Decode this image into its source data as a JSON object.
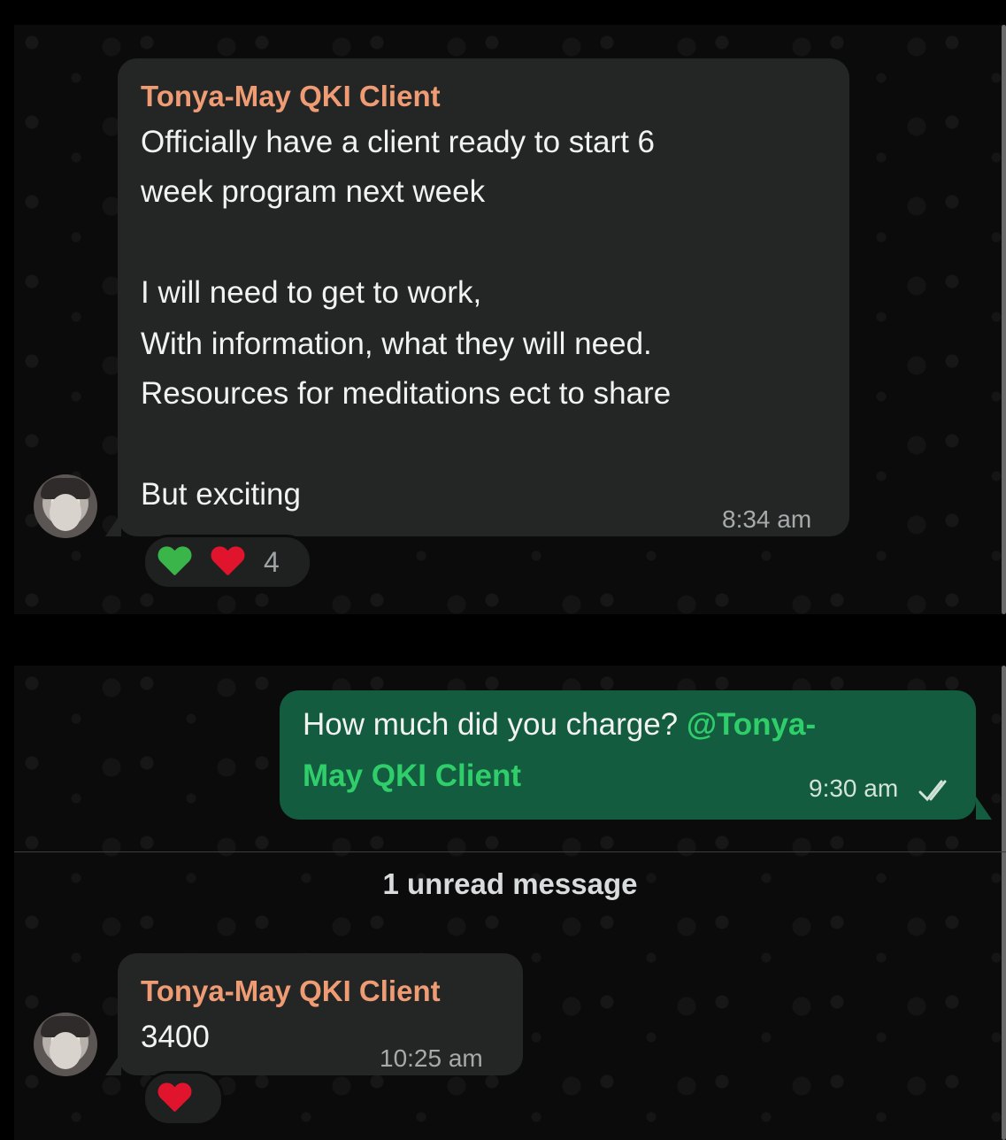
{
  "chat": {
    "message1": {
      "sender": "Tonya-May QKI Client",
      "lines": [
        "Officially have a client ready to start 6",
        "week program next week",
        "",
        "I will need to get to work,",
        "With information, what they will need.",
        "Resources for meditations ect to share",
        "",
        "But exciting"
      ],
      "time": "8:34 am",
      "reactions": {
        "emojis": [
          "green-heart",
          "red-heart"
        ],
        "count": "4"
      }
    },
    "message2": {
      "text_prefix": "How much did you charge?",
      "mention_part1": "@Tonya-",
      "mention_part2": "May QKI Client",
      "time": "9:30 am",
      "status": "read-double-check-icon"
    },
    "unread_divider": {
      "label": "1 unread message"
    },
    "message3": {
      "sender": "Tonya-May QKI Client",
      "text": "3400",
      "time": "10:25 am",
      "reactions": {
        "emojis": [
          "red-heart"
        ]
      }
    }
  },
  "colors": {
    "background": "#000000",
    "panel": "#0b0b0b",
    "incoming_bubble": "#242626",
    "outgoing_bubble": "#145c3f",
    "sender_name": "#ef9b74",
    "mention": "#2fce6b",
    "green_heart": "#39b54a",
    "red_heart": "#e0142c"
  }
}
